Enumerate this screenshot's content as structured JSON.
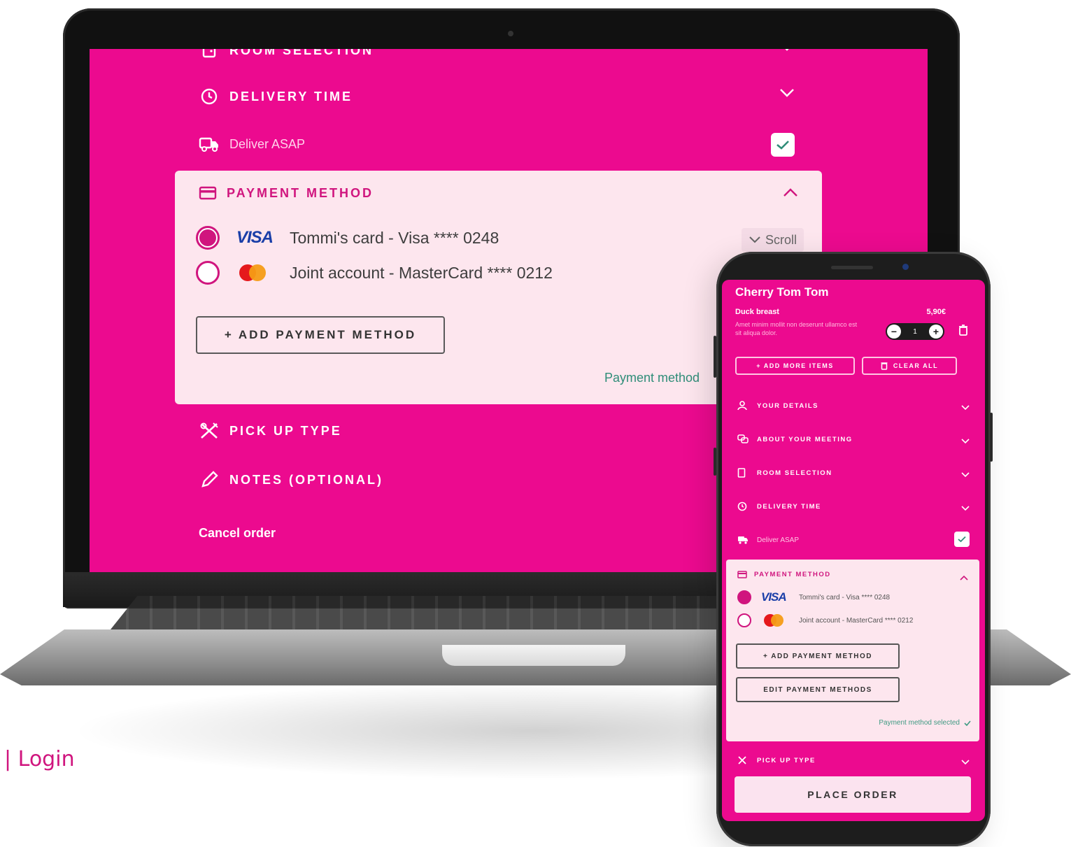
{
  "laptop": {
    "sections": {
      "room_selection": "ROOM SELECTION",
      "delivery_time": "DELIVERY TIME",
      "deliver_asap": "Deliver ASAP",
      "payment_method": "PAYMENT METHOD",
      "pick_up_type": "PICK UP TYPE",
      "notes": "NOTES (OPTIONAL)"
    },
    "cards": [
      {
        "brand": "VISA",
        "label": "Tommi's card - Visa **** 0248",
        "selected": true
      },
      {
        "brand": "mastercard",
        "label": "Joint account - MasterCard **** 0212",
        "selected": false
      }
    ],
    "add_payment_label": "+ ADD PAYMENT METHOD",
    "scroll_label": "Scroll",
    "payment_selected_text": "Payment method",
    "cancel_label": "Cancel order"
  },
  "phone": {
    "restaurant": "Cherry Tom Tom",
    "item": {
      "name": "Duck breast",
      "price": "5,90€",
      "description": "Amet minim mollit non deserunt ullamco est sit aliqua dolor.",
      "quantity": "1"
    },
    "add_more_label": "+ ADD MORE ITEMS",
    "clear_all_label": "CLEAR ALL",
    "sections": {
      "your_details": "YOUR DETAILS",
      "about_meeting": "ABOUT YOUR MEETING",
      "room_selection": "ROOM SELECTION",
      "delivery_time": "DELIVERY TIME",
      "deliver_asap": "Deliver ASAP",
      "payment_method": "PAYMENT METHOD",
      "pick_up_type": "PICK UP TYPE"
    },
    "cards": [
      {
        "brand": "VISA",
        "label": "Tommi's card - Visa **** 0248",
        "selected": true
      },
      {
        "brand": "mastercard",
        "label": "Joint account - MasterCard **** 0212",
        "selected": false
      }
    ],
    "add_payment_label": "+ ADD PAYMENT METHOD",
    "edit_payment_label": "EDIT PAYMENT METHODS",
    "payment_selected_text": "Payment method selected",
    "place_order_label": "PLACE ORDER"
  },
  "footer": {
    "login_text": "|  Login"
  },
  "colors": {
    "brand_pink": "#ec0a8f",
    "panel_pink": "#fde6ee",
    "accent": "#d0157e",
    "success": "#2f8d78"
  }
}
